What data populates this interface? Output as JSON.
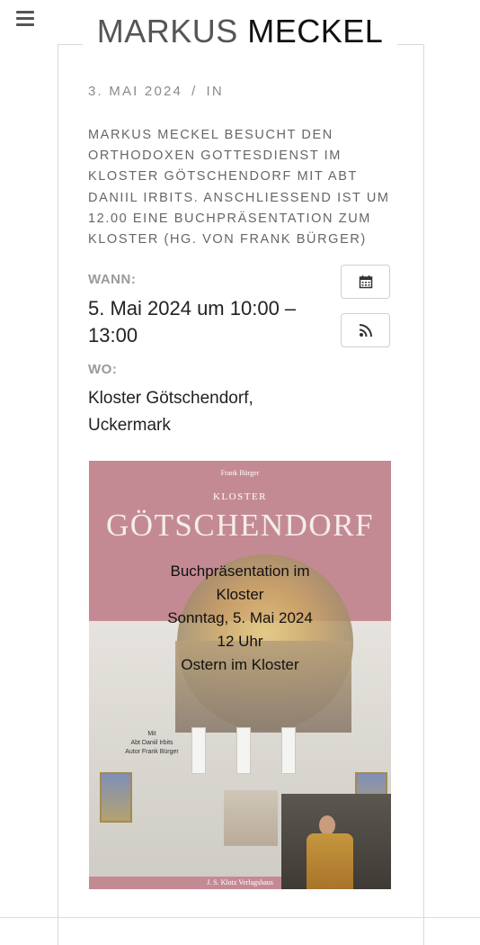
{
  "header": {
    "title_first": "MARKUS",
    "title_last": "MECKEL",
    "menu_icon": "hamburger-menu-icon"
  },
  "post": {
    "date": "3. MAI 2024",
    "separator": "/",
    "category_prefix": "IN",
    "summary": "MARKUS MECKEL BESUCHT DEN ORTHODOXEN GOTTESDIENST IM KLOSTER GÖTSCHENDORF MIT ABT DANIIL IRBITS. ANSCHLIESSEND IST UM 12.00 EINE BUCHPRÄSENTATION ZUM KLOSTER (HG. VON FRANK BÜRGER)"
  },
  "event": {
    "when_label": "WANN:",
    "when_value": "5. Mai 2024 um 10:00 – 13:00",
    "where_label": "WO:",
    "where_value": "Kloster Götschendorf, Uckermark",
    "calendar_icon": "calendar-icon",
    "rss_icon": "rss-feed-icon"
  },
  "poster": {
    "author": "Frank Bürger",
    "kicker": "KLOSTER",
    "title": "GÖTSCHENDORF",
    "overlay": [
      "Buchpräsentation im",
      "Kloster",
      "Sonntag, 5. Mai 2024",
      "12 Uhr",
      "Ostern im Kloster"
    ],
    "small_text": [
      "Mit",
      "Abt Daniil Irbits",
      "Autor Frank Bürger"
    ],
    "publisher": "J. S. Klotz Verlagshaus"
  },
  "colors": {
    "poster_band": "#c48a93",
    "label_gray": "#9a9a9a",
    "meta_gray": "#8a8a8a"
  }
}
